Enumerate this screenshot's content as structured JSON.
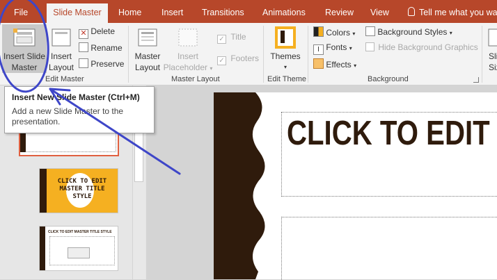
{
  "tabs": {
    "file": "File",
    "slide_master": "Slide Master",
    "home": "Home",
    "insert": "Insert",
    "transitions": "Transitions",
    "animations": "Animations",
    "review": "Review",
    "view": "View",
    "tell_me": "Tell me what you wa"
  },
  "ribbon": {
    "edit_master": {
      "insert_slide_master": [
        "Insert Slide",
        "Master"
      ],
      "insert_layout": [
        "Insert",
        "Layout"
      ],
      "delete": "Delete",
      "rename": "Rename",
      "preserve": "Preserve",
      "group_label": "Edit Master"
    },
    "master_layout": {
      "master_layout": [
        "Master",
        "Layout"
      ],
      "insert_placeholder": [
        "Insert",
        "Placeholder"
      ],
      "title": "Title",
      "footers": "Footers",
      "group_label": "Master Layout"
    },
    "edit_theme": {
      "themes": "Themes",
      "group_label": "Edit Theme"
    },
    "background": {
      "colors": "Colors",
      "fonts": "Fonts",
      "effects": "Effects",
      "background_styles": "Background Styles",
      "hide_background_graphics": "Hide Background Graphics",
      "group_label": "Background"
    },
    "size": [
      "Sli",
      "Siz"
    ]
  },
  "tooltip": {
    "title": "Insert New Slide Master (Ctrl+M)",
    "body": "Add a new Slide Master to the presentation."
  },
  "thumbnails": {
    "thumb2": [
      "CLICK TO EDIT",
      "MASTER TITLE",
      "STYLE"
    ],
    "thumb3": "CLICK TO EDIT MASTER TITLE STYLE"
  },
  "slide": {
    "title_placeholder": "CLICK TO EDIT"
  },
  "colors": {
    "accent": "#b7472a",
    "slide_dark": "#2f1b0c",
    "thumb_orange": "#f5b021",
    "annotation": "#3e46c8"
  }
}
